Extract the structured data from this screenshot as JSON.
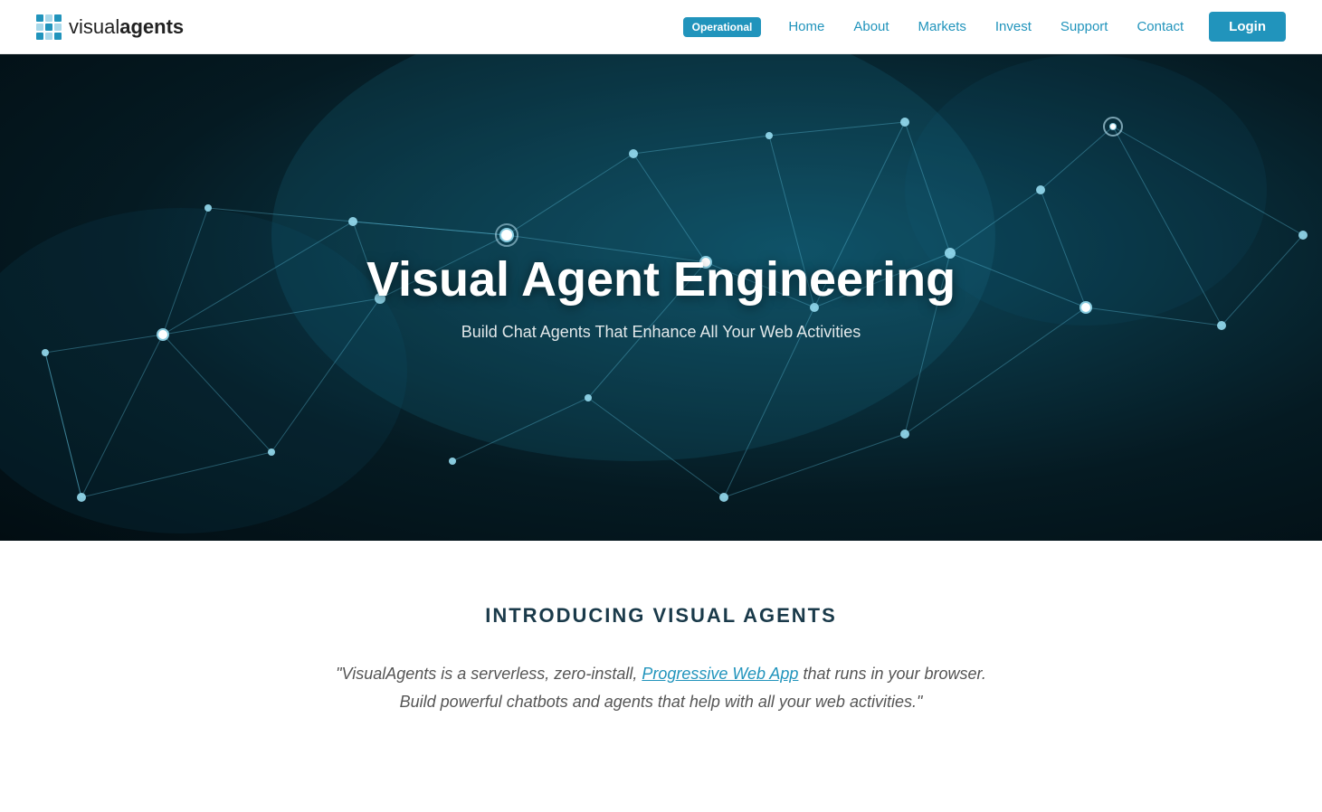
{
  "nav": {
    "logo_text_regular": "visual",
    "logo_text_bold": "agents",
    "status_badge": "Operational",
    "links": [
      {
        "label": "Home",
        "id": "home"
      },
      {
        "label": "About",
        "id": "about"
      },
      {
        "label": "Markets",
        "id": "markets"
      },
      {
        "label": "Invest",
        "id": "invest"
      },
      {
        "label": "Support",
        "id": "support"
      },
      {
        "label": "Contact",
        "id": "contact"
      }
    ],
    "login_label": "Login"
  },
  "hero": {
    "title": "Visual Agent Engineering",
    "subtitle": "Build Chat Agents That Enhance All Your Web Activities"
  },
  "intro": {
    "title": "INTRODUCING VISUAL AGENTS",
    "quote_before": "\"VisualAgents is a serverless, zero-install, ",
    "quote_link": "Progressive Web App",
    "quote_after": " that runs in your browser. Build powerful chatbots and agents that help with all your web activities.\""
  },
  "colors": {
    "accent": "#2194bc",
    "dark_text": "#1a3a4a"
  }
}
